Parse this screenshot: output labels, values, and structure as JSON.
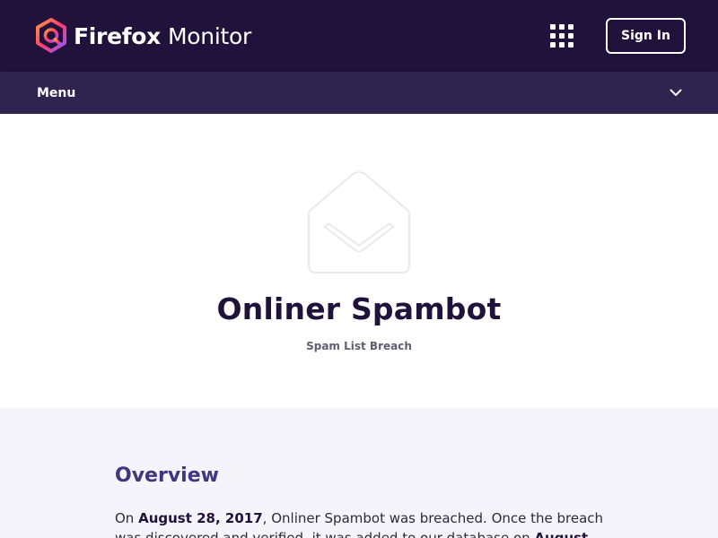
{
  "header": {
    "brand_firefox": "Firefox",
    "brand_monitor": "Monitor",
    "apps_icon": "app-grid-icon",
    "signin_label": "Sign In"
  },
  "menubar": {
    "label": "Menu",
    "icon": "chevron-down-icon"
  },
  "hero": {
    "icon": "open-envelope-icon",
    "title": "Onliner Spambot",
    "subtitle": "Spam List Breach"
  },
  "overview": {
    "heading": "Overview",
    "text_prefix": "On ",
    "breach_date": "August 28, 2017",
    "text_middle": ", Onliner Spambot was breached. Once the breach was discovered and verified, it was added to our database on ",
    "added_date": "August"
  },
  "colors": {
    "header_bg": "#20123a",
    "menubar_bg": "#2f2450",
    "overview_bg": "#f6f4fb",
    "heading_color": "#3d3880"
  }
}
